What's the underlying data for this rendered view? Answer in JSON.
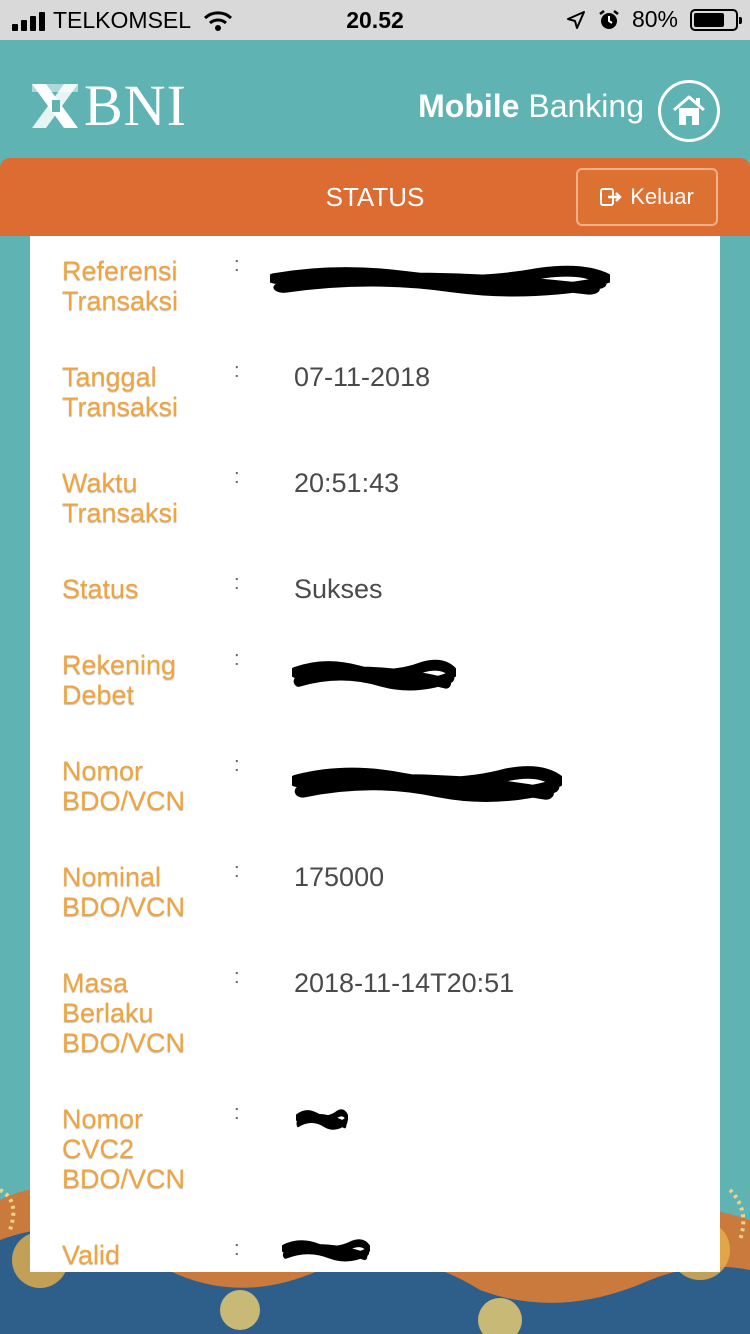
{
  "status_bar": {
    "carrier": "TELKOMSEL",
    "time": "20.52",
    "battery": "80%",
    "battery_level": 0.8
  },
  "header": {
    "logo": "BNI",
    "title_bold": "Mobile",
    "title_regular": "Banking"
  },
  "toolbar": {
    "title": "STATUS",
    "logout_label": "Keluar"
  },
  "details": {
    "colon": ":",
    "rows": [
      {
        "label": "Referensi Transaksi",
        "value": ""
      },
      {
        "label": "Tanggal Transaksi",
        "value": "07-11-2018"
      },
      {
        "label": "Waktu Transaksi",
        "value": "20:51:43"
      },
      {
        "label": "Status",
        "value": "Sukses"
      },
      {
        "label": "Rekening Debet",
        "value": ""
      },
      {
        "label": "Nomor BDO/VCN",
        "value": ""
      },
      {
        "label": "Nominal BDO/VCN",
        "value": "175000"
      },
      {
        "label": "Masa Berlaku BDO/VCN",
        "value": "2018-11-14T20:51"
      },
      {
        "label": "Nomor CVC2 BDO/VCN",
        "value": ""
      },
      {
        "label": "Valid",
        "value": ""
      }
    ]
  },
  "colors": {
    "teal": "#5fb3b3",
    "orange": "#dd6c33",
    "label": "#efa43c"
  }
}
